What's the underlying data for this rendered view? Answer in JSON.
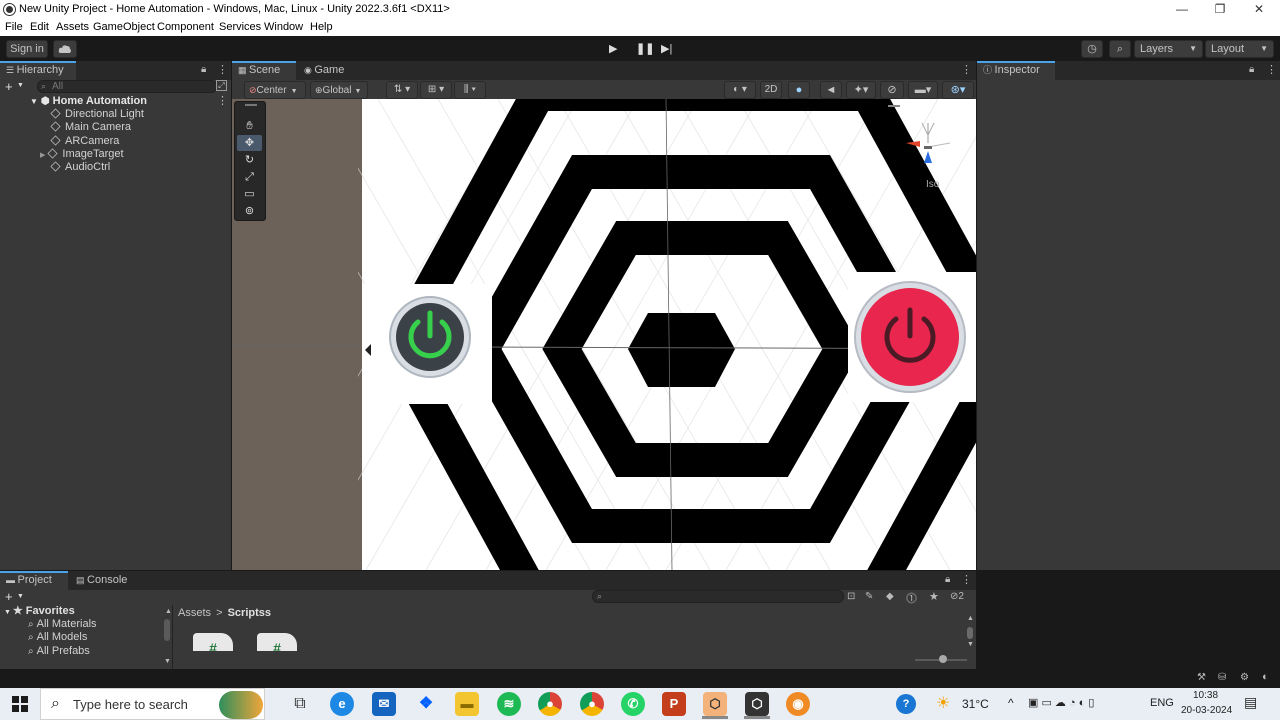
{
  "window": {
    "title": "New Unity Project - Home Automation - Windows, Mac, Linux - Unity 2022.3.6f1 <DX11>",
    "minimize": "—",
    "maximize": "❐",
    "close": "✕"
  },
  "menu": [
    "File",
    "Edit",
    "Assets",
    "GameObject",
    "Component",
    "Services",
    "Window",
    "Help"
  ],
  "toolbar": {
    "sign_in": "Sign in",
    "layers": "Layers",
    "layout": "Layout"
  },
  "hierarchy": {
    "tab": "Hierarchy",
    "search_placeholder": "All",
    "scene": "Home Automation",
    "items": [
      "Directional Light",
      "Main Camera",
      "ARCamera",
      "ImageTarget",
      "AudioCtrl"
    ]
  },
  "scene": {
    "tabs": [
      "Scene",
      "Game"
    ],
    "pivot": "Center",
    "space": "Global",
    "mode_2d": "2D",
    "gizmo_label": "Iso"
  },
  "inspector": {
    "tab": "Inspector"
  },
  "project": {
    "tabs": [
      "Project",
      "Console"
    ],
    "favorites": "Favorites",
    "favorite_items": [
      "All Materials",
      "All Models",
      "All Prefabs"
    ],
    "breadcrumb": [
      "Assets",
      "Scriptss"
    ],
    "hidden_count": "2"
  },
  "taskbar": {
    "search_placeholder": "Type here to search",
    "weather": "31°C",
    "language": "ENG",
    "time": "10:38",
    "date": "20-03-2024"
  }
}
